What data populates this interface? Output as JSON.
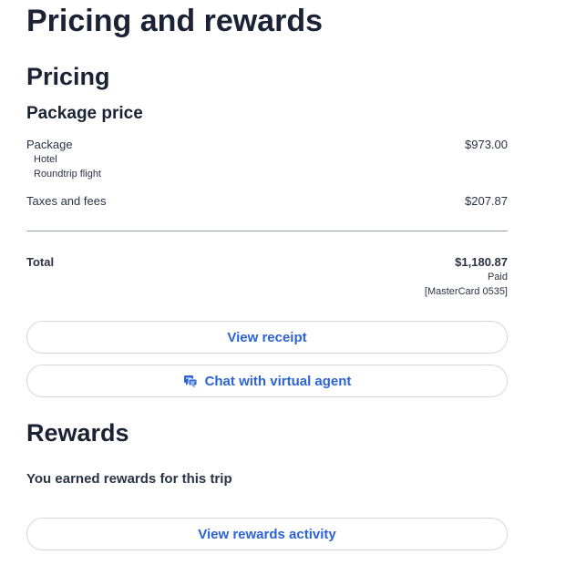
{
  "page": {
    "title": "Pricing and rewards"
  },
  "pricing": {
    "title": "Pricing",
    "subtitle": "Package price",
    "package": {
      "label": "Package",
      "value": "$973.00",
      "items": [
        "Hotel",
        "Roundtrip flight"
      ]
    },
    "taxes": {
      "label": "Taxes and fees",
      "value": "$207.87"
    },
    "total": {
      "label": "Total",
      "value": "$1,180.87",
      "status": "Paid",
      "payment_method": "[MasterCard 0535]"
    },
    "view_receipt_label": "View receipt",
    "chat_label": "Chat with virtual agent",
    "chat_icon": "chat-bubbles-icon"
  },
  "rewards": {
    "title": "Rewards",
    "message": "You earned rewards for this trip",
    "view_activity_label": "View rewards activity"
  },
  "colors": {
    "accent": "#2c63d4",
    "text": "#1b2233",
    "border": "#d3d7dd"
  }
}
